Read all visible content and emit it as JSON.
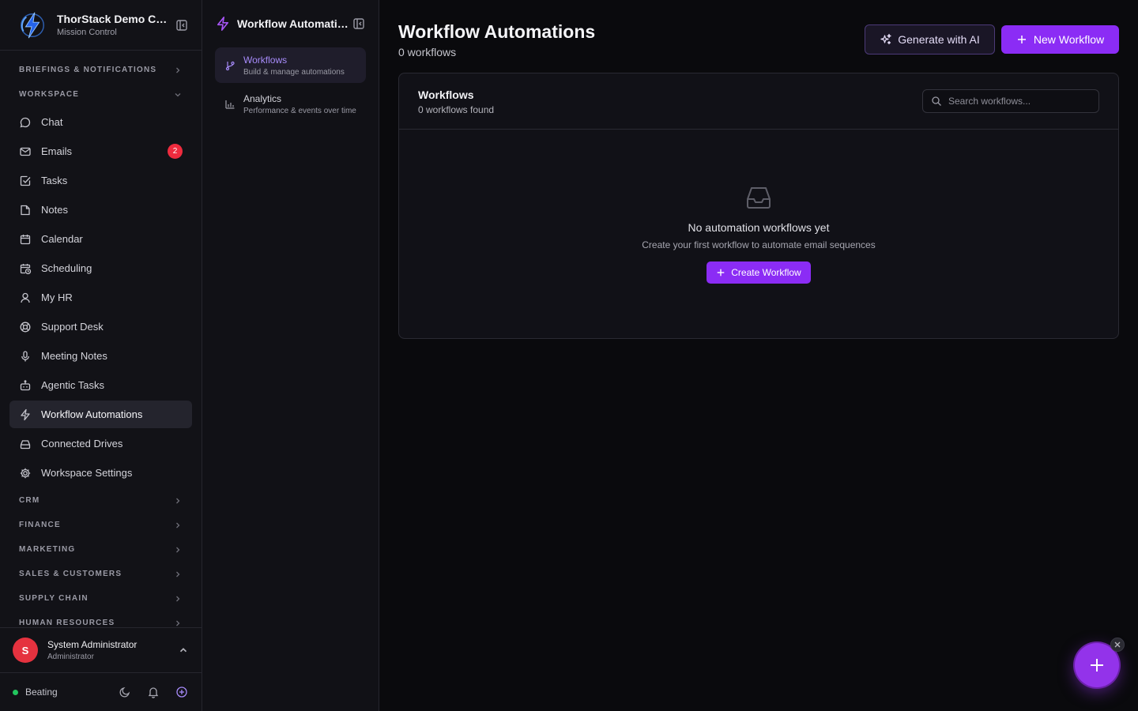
{
  "brand": {
    "name": "ThorStack Demo Company",
    "subtitle": "Mission Control"
  },
  "sidebar": {
    "sections_top": [
      {
        "label": "BRIEFINGS & NOTIFICATIONS"
      },
      {
        "label": "WORKSPACE"
      }
    ],
    "items": [
      {
        "label": "Chat",
        "icon": "chat-icon"
      },
      {
        "label": "Emails",
        "icon": "mail-icon",
        "badge": "2"
      },
      {
        "label": "Tasks",
        "icon": "checkbox-icon"
      },
      {
        "label": "Notes",
        "icon": "note-icon"
      },
      {
        "label": "Calendar",
        "icon": "calendar-icon"
      },
      {
        "label": "Scheduling",
        "icon": "calendar-clock-icon"
      },
      {
        "label": "My HR",
        "icon": "user-icon"
      },
      {
        "label": "Support Desk",
        "icon": "lifebuoy-icon"
      },
      {
        "label": "Meeting Notes",
        "icon": "mic-icon"
      },
      {
        "label": "Agentic Tasks",
        "icon": "bot-icon"
      },
      {
        "label": "Workflow Automations",
        "icon": "bolt-icon",
        "active": true
      },
      {
        "label": "Connected Drives",
        "icon": "drive-icon"
      },
      {
        "label": "Workspace Settings",
        "icon": "gear-icon"
      }
    ],
    "sections_bottom": [
      {
        "label": "CRM"
      },
      {
        "label": "FINANCE"
      },
      {
        "label": "MARKETING"
      },
      {
        "label": "SALES & CUSTOMERS"
      },
      {
        "label": "SUPPLY CHAIN"
      },
      {
        "label": "HUMAN RESOURCES"
      }
    ]
  },
  "user": {
    "initial": "S",
    "name": "System Administrator",
    "role": "Administrator"
  },
  "footer": {
    "status": "Beating",
    "status_color": "#22c55e"
  },
  "subbar": {
    "title": "Workflow Automations",
    "items": [
      {
        "label": "Workflows",
        "desc": "Build & manage automations",
        "active": true
      },
      {
        "label": "Analytics",
        "desc": "Performance & events over time"
      }
    ]
  },
  "main": {
    "title": "Workflow Automations",
    "subtitle": "0 workflows",
    "generate_label": "Generate with AI",
    "new_label": "New Workflow",
    "card": {
      "title": "Workflows",
      "subtitle": "0 workflows found",
      "search_placeholder": "Search workflows...",
      "empty_title": "No automation workflows yet",
      "empty_sub": "Create your first workflow to automate email sequences",
      "create_label": "Create Workflow"
    }
  },
  "colors": {
    "accent": "#8b2cf5",
    "accent_light": "#a78bfa",
    "badge": "#ef2b3e",
    "avatar": "#e5323f"
  }
}
